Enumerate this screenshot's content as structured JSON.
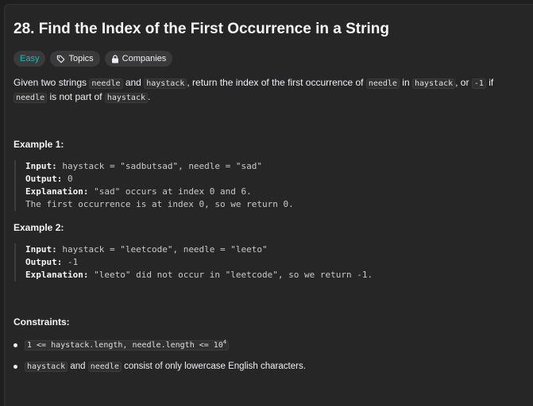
{
  "problem": {
    "title": "28. Find the Index of the First Occurrence in a String",
    "tags": {
      "difficulty": "Easy",
      "topics": "Topics",
      "companies": "Companies"
    },
    "description": {
      "p1": "Given two strings ",
      "c1": "needle",
      "p2": " and ",
      "c2": "haystack",
      "p3": ", return the index of the first occurrence of ",
      "c3": "needle",
      "p4": " in ",
      "c4": "haystack",
      "p5": ", or ",
      "c5": "-1",
      "p6": " if ",
      "c6": "needle",
      "p7": " is not part of ",
      "c7": "haystack",
      "p8": "."
    }
  },
  "examples": [
    {
      "title": "Example 1:",
      "input_label": "Input:",
      "input": " haystack = \"sadbutsad\", needle = \"sad\"",
      "output_label": "Output:",
      "output": " 0",
      "explanation_label": "Explanation:",
      "explanation": " \"sad\" occurs at index 0 and 6.",
      "explanation2": "The first occurrence is at index 0, so we return 0."
    },
    {
      "title": "Example 2:",
      "input_label": "Input:",
      "input": " haystack = \"leetcode\", needle = \"leeto\"",
      "output_label": "Output:",
      "output": " -1",
      "explanation_label": "Explanation:",
      "explanation": " \"leeto\" did not occur in \"leetcode\", so we return -1."
    }
  ],
  "constraints": {
    "title": "Constraints:",
    "c1_code": "1 <= haystack.length, needle.length <= 10",
    "c1_sup": "4",
    "c2_code1": "haystack",
    "c2_text1": " and ",
    "c2_code2": "needle",
    "c2_text2": " consist of only lowercase English characters."
  },
  "colors": {
    "easy": "#1cb8b8",
    "background": "#262626"
  }
}
